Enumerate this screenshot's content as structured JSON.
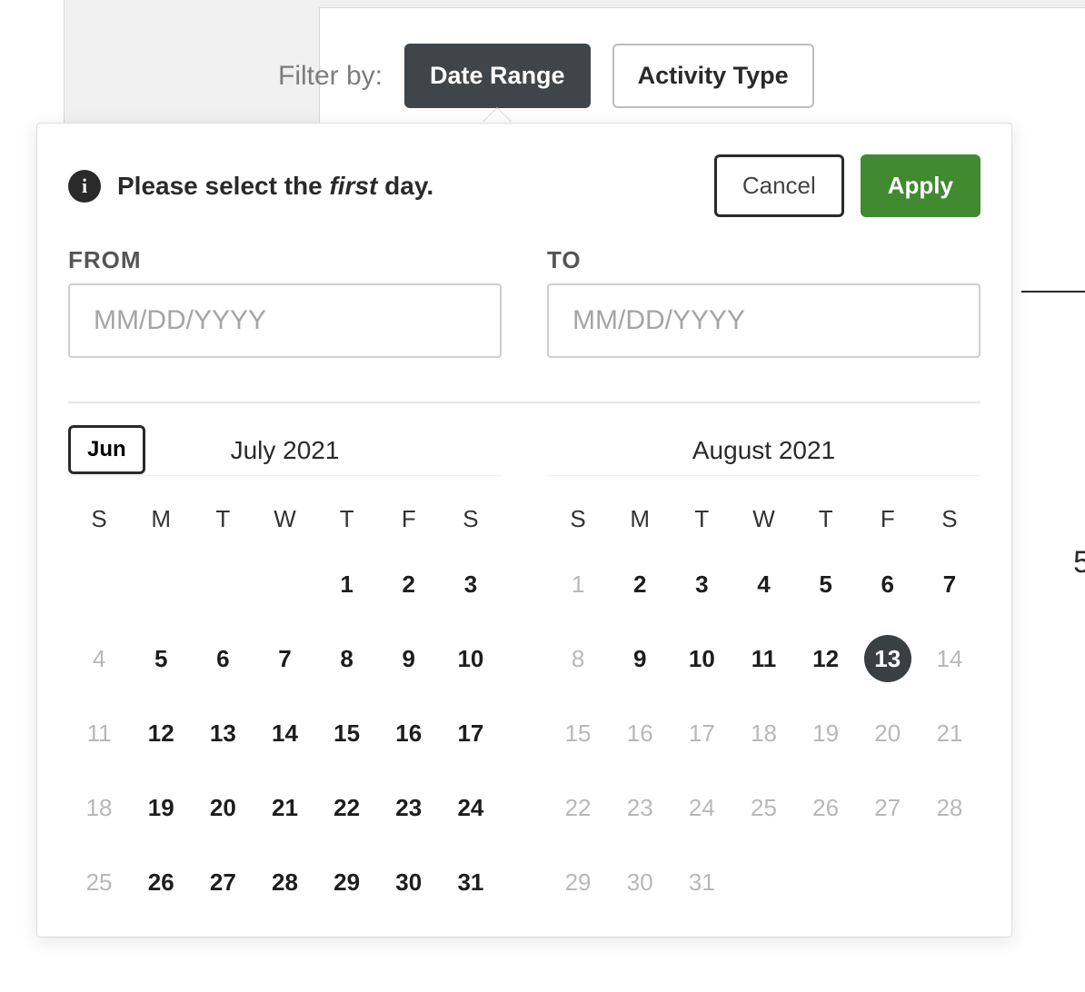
{
  "filter": {
    "label": "Filter by:",
    "date_range_label": "Date Range",
    "activity_type_label": "Activity Type",
    "active": "date_range"
  },
  "popover": {
    "instruction_pre": "Please select the ",
    "instruction_em": "first",
    "instruction_post": " day.",
    "cancel_label": "Cancel",
    "apply_label": "Apply",
    "from_label": "FROM",
    "to_label": "TO",
    "from_value": "",
    "to_value": "",
    "placeholder": "MM/DD/YYYY",
    "prev_month_label": "Jun"
  },
  "weekdays": [
    "S",
    "M",
    "T",
    "W",
    "T",
    "F",
    "S"
  ],
  "calendars": [
    {
      "title": "July 2021",
      "prev_visible": true,
      "leading_blanks": 4,
      "days": [
        {
          "n": 1
        },
        {
          "n": 2
        },
        {
          "n": 3
        },
        {
          "n": 4,
          "dim": true
        },
        {
          "n": 5
        },
        {
          "n": 6
        },
        {
          "n": 7
        },
        {
          "n": 8
        },
        {
          "n": 9
        },
        {
          "n": 10
        },
        {
          "n": 11,
          "dim": true
        },
        {
          "n": 12
        },
        {
          "n": 13
        },
        {
          "n": 14
        },
        {
          "n": 15
        },
        {
          "n": 16
        },
        {
          "n": 17
        },
        {
          "n": 18,
          "dim": true
        },
        {
          "n": 19
        },
        {
          "n": 20
        },
        {
          "n": 21
        },
        {
          "n": 22
        },
        {
          "n": 23
        },
        {
          "n": 24
        },
        {
          "n": 25,
          "dim": true
        },
        {
          "n": 26
        },
        {
          "n": 27
        },
        {
          "n": 28
        },
        {
          "n": 29
        },
        {
          "n": 30
        },
        {
          "n": 31
        }
      ]
    },
    {
      "title": "August 2021",
      "prev_visible": false,
      "leading_blanks": 0,
      "days": [
        {
          "n": 1,
          "dim": true
        },
        {
          "n": 2
        },
        {
          "n": 3
        },
        {
          "n": 4
        },
        {
          "n": 5
        },
        {
          "n": 6
        },
        {
          "n": 7
        },
        {
          "n": 8,
          "dim": true
        },
        {
          "n": 9
        },
        {
          "n": 10
        },
        {
          "n": 11
        },
        {
          "n": 12
        },
        {
          "n": 13,
          "today": true
        },
        {
          "n": 14,
          "dim": true
        },
        {
          "n": 15,
          "dim": true
        },
        {
          "n": 16,
          "dim": true
        },
        {
          "n": 17,
          "dim": true
        },
        {
          "n": 18,
          "dim": true
        },
        {
          "n": 19,
          "dim": true
        },
        {
          "n": 20,
          "dim": true
        },
        {
          "n": 21,
          "dim": true
        },
        {
          "n": 22,
          "dim": true
        },
        {
          "n": 23,
          "dim": true
        },
        {
          "n": 24,
          "dim": true
        },
        {
          "n": 25,
          "dim": true
        },
        {
          "n": 26,
          "dim": true
        },
        {
          "n": 27,
          "dim": true
        },
        {
          "n": 28,
          "dim": true
        },
        {
          "n": 29,
          "dim": true
        },
        {
          "n": 30,
          "dim": true
        },
        {
          "n": 31,
          "dim": true
        }
      ]
    }
  ],
  "side_fragment_number": "5"
}
